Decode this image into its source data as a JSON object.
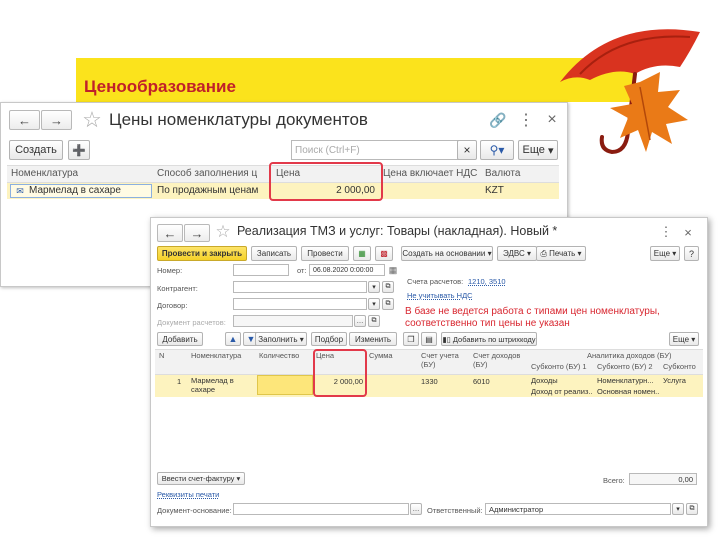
{
  "slide": {
    "title": "Ценообразование"
  },
  "win1": {
    "title": "Цены номенклатуры документов",
    "create_label": "Создать",
    "search_placeholder": "Поиск (Ctrl+F)",
    "clear_icon": "×",
    "more_label": "Еще",
    "columns": [
      "Номенклатура",
      "Способ заполнения ц",
      "Цена",
      "Цена включает НДС",
      "Валюта"
    ],
    "row": {
      "item": "Мармелад в сахаре",
      "method": "По продажным ценам",
      "price": "2 000,00",
      "vat": "",
      "currency": "KZT"
    }
  },
  "win2": {
    "title": "Реализация ТМЗ и услуг: Товары (накладная). Новый *",
    "toolbar": {
      "post_close": "Провести и закрыть",
      "save": "Записать",
      "post": "Провести",
      "create_based": "Создать на основании",
      "esf": "ЭДВС",
      "print": "Печать",
      "more": "Еще"
    },
    "form": {
      "number_label": "Номер:",
      "date_prefix": "от:",
      "date_value": "06.08.2020  0:00:00",
      "accounts_label": "Счета расчетов:",
      "accounts_value": "1210, 3510",
      "vat_link": "Не учитывать НДС",
      "counterparty_label": "Контрагент:",
      "contract_label": "Договор:",
      "settlement_doc_label": "Документ расчетов:",
      "note": "В базе не ведется работа с типами цен номенклатуры, соответственно тип цены не указан"
    },
    "table_toolbar": {
      "add": "Добавить",
      "fill": "Заполнить",
      "selection": "Подбор",
      "change": "Изменить",
      "barcode": "Добавить по штрихкоду",
      "more": "Еще"
    },
    "columns": {
      "n": "N",
      "item": "Номенклатура",
      "qty": "Количество",
      "price": "Цена",
      "sum": "Сумма",
      "acc_account": "Счет учета (БУ)",
      "income_account": "Счет доходов (БУ)",
      "analytics": "Аналитика доходов (БУ)",
      "sub1": "Субконто (БУ) 1",
      "sub2": "Субконто (БУ) 2",
      "sub3": "Субконто"
    },
    "row": {
      "n": "1",
      "item": "Мармелад в сахаре",
      "qty": "",
      "price": "2 000,00",
      "sum": "",
      "acc_account": "1330",
      "income_account": "6010",
      "sub1_a": "Доходы",
      "sub1_b": "Доход от реализ...",
      "sub2_a": "Номенклатурн...",
      "sub2_b": "Основная номен...",
      "sub3": "Услуга"
    },
    "footer": {
      "invoice_btn": "Ввести счет-фактуру",
      "print_details": "Реквизиты печати",
      "total_label": "Всего:",
      "total_value": "0,00",
      "base_doc_label": "Документ-основание:",
      "responsible_label": "Ответственный:",
      "responsible_value": "Администратор"
    }
  },
  "colors": {
    "accent_yellow": "#fbe31c",
    "title_red": "#c0202a",
    "highlight_red": "#e2394a",
    "link_blue": "#2a5aa8",
    "selected_row": "#fdf3bf"
  }
}
